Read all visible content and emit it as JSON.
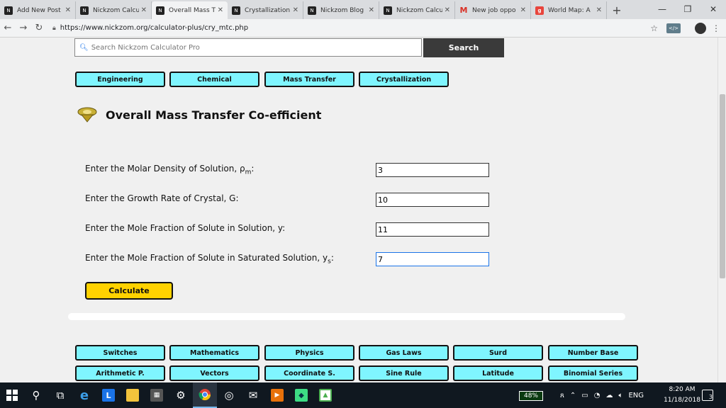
{
  "browser": {
    "tabs": [
      {
        "label": "Add New Post",
        "favicon": "nickzom-icon",
        "active": false
      },
      {
        "label": "Nickzom Calcu",
        "favicon": "nickzom-icon",
        "active": false
      },
      {
        "label": "Overall Mass T",
        "favicon": "nickzom-icon",
        "active": true
      },
      {
        "label": "Crystallization",
        "favicon": "nickzom-icon",
        "active": false
      },
      {
        "label": "Nickzom Blog",
        "favicon": "nickzom-icon",
        "active": false
      },
      {
        "label": "Nickzom Calcu",
        "favicon": "nickzom-icon",
        "active": false
      },
      {
        "label": "New job oppo",
        "favicon": "gmail-icon",
        "active": false
      },
      {
        "label": "World Map: A",
        "favicon": "google-icon",
        "active": false
      }
    ],
    "url": "https://www.nickzom.org/calculator-plus/cry_mtc.php"
  },
  "page": {
    "search": {
      "placeholder": "Search Nickzom Calculator Pro",
      "button_label": "Search"
    },
    "top_categories": [
      "Engineering",
      "Chemical",
      "Mass Transfer",
      "Crystallization"
    ],
    "title": "Overall Mass Transfer Co-efficient",
    "fields": [
      {
        "label": "Enter the Molar Density of Solution, ρ",
        "sub": "m",
        "suffix": ":",
        "value": "3"
      },
      {
        "label": "Enter the Growth Rate of Crystal, G:",
        "sub": "",
        "suffix": "",
        "value": "10"
      },
      {
        "label": "Enter the Mole Fraction of Solute in Solution, y:",
        "sub": "",
        "suffix": "",
        "value": "11"
      },
      {
        "label": "Enter the Mole Fraction of Solute in Saturated Solution, y",
        "sub": "s",
        "suffix": ":",
        "value": "7"
      }
    ],
    "calculate_label": "Calculate",
    "bottom_categories_row1": [
      "Switches",
      "Mathematics",
      "Physics",
      "Gas Laws",
      "Surd",
      "Number Base"
    ],
    "bottom_categories_row2": [
      "Arithmetic P.",
      "Vectors",
      "Coordinate S.",
      "Sine Rule",
      "Latitude",
      "Binomial Series"
    ]
  },
  "taskbar": {
    "battery": "48%",
    "language": "ENG",
    "time": "8:20 AM",
    "date": "11/18/2018",
    "notifications": "3"
  },
  "colors": {
    "category_button": "#7ff5ff",
    "calculate_button": "#ffd200",
    "search_button": "#3a3a3a"
  }
}
